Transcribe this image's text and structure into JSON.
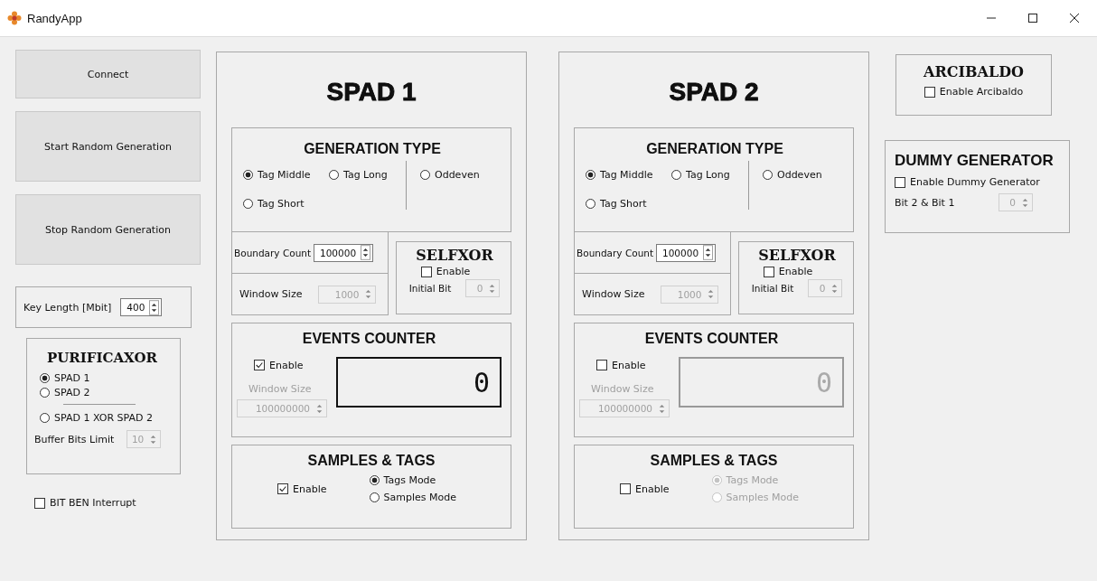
{
  "window": {
    "title": "RandyApp"
  },
  "sidebar": {
    "buttons": [
      "Connect",
      "Start Random Generation",
      "Stop Random Generation"
    ],
    "key_length": {
      "label": "Key Length [Mbit]",
      "value": "400",
      "disabled": false
    },
    "purificaxor": {
      "title": "PURIFICAXOR",
      "options": [
        {
          "label": "SPAD 1",
          "selected": true
        },
        {
          "label": "SPAD 2",
          "selected": false
        },
        {
          "label": "SPAD 1 XOR SPAD 2",
          "selected": false
        }
      ],
      "buffer": {
        "label": "Buffer Bits Limit",
        "value": "10",
        "disabled": true
      }
    },
    "bit_ben": {
      "label": "BIT BEN Interrupt",
      "checked": false
    }
  },
  "spads": [
    {
      "title": "SPAD 1",
      "generation_type": {
        "title": "GENERATION TYPE",
        "options": [
          {
            "label": "Tag Middle",
            "selected": true
          },
          {
            "label": "Tag Long",
            "selected": false
          },
          {
            "label": "Oddeven",
            "selected": false
          },
          {
            "label": "Tag Short",
            "selected": false
          }
        ]
      },
      "boundary_count": {
        "label": "Boundary Count",
        "value": "100000",
        "disabled": false
      },
      "window_size": {
        "label": "Window Size",
        "value": "1000",
        "disabled": true
      },
      "selfxor": {
        "title": "SELFXOR",
        "enable": {
          "label": "Enable",
          "checked": false
        },
        "initial_bit": {
          "label": "Initial Bit",
          "value": "0",
          "disabled": true
        }
      },
      "events_counter": {
        "title": "EVENTS COUNTER",
        "enable": {
          "label": "Enable",
          "checked": true
        },
        "window_size": {
          "label": "Window Size",
          "value": "100000000",
          "disabled": true
        },
        "display": "0"
      },
      "samples_tags": {
        "title": "SAMPLES & TAGS",
        "enable": {
          "label": "Enable",
          "checked": true
        },
        "modes": [
          {
            "label": "Tags Mode",
            "selected": true
          },
          {
            "label": "Samples Mode",
            "selected": false
          }
        ]
      }
    },
    {
      "title": "SPAD 2",
      "generation_type": {
        "title": "GENERATION TYPE",
        "options": [
          {
            "label": "Tag Middle",
            "selected": true
          },
          {
            "label": "Tag Long",
            "selected": false
          },
          {
            "label": "Oddeven",
            "selected": false
          },
          {
            "label": "Tag Short",
            "selected": false
          }
        ]
      },
      "boundary_count": {
        "label": "Boundary Count",
        "value": "100000",
        "disabled": false
      },
      "window_size": {
        "label": "Window Size",
        "value": "1000",
        "disabled": true
      },
      "selfxor": {
        "title": "SELFXOR",
        "enable": {
          "label": "Enable",
          "checked": false
        },
        "initial_bit": {
          "label": "Initial Bit",
          "value": "0",
          "disabled": true
        }
      },
      "events_counter": {
        "title": "EVENTS COUNTER",
        "enable": {
          "label": "Enable",
          "checked": false
        },
        "window_size": {
          "label": "Window Size",
          "value": "100000000",
          "disabled": true
        },
        "display": "0"
      },
      "samples_tags": {
        "title": "SAMPLES & TAGS",
        "enable": {
          "label": "Enable",
          "checked": false
        },
        "modes": [
          {
            "label": "Tags Mode",
            "selected": true
          },
          {
            "label": "Samples Mode",
            "selected": false
          }
        ]
      }
    }
  ],
  "arcibaldo": {
    "title": "ARCIBALDO",
    "enable": {
      "label": "Enable Arcibaldo",
      "checked": false
    }
  },
  "dummy_generator": {
    "title": "DUMMY GENERATOR",
    "enable": {
      "label": "Enable Dummy Generator",
      "checked": false
    },
    "bits": {
      "label": "Bit 2 & Bit 1",
      "value": "0",
      "disabled": true
    }
  }
}
